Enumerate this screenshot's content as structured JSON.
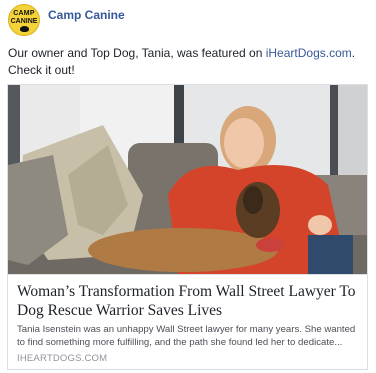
{
  "post": {
    "page_name": "Camp Canine",
    "avatar": {
      "logo_top": "CAMP",
      "logo_bottom": "CANINE",
      "colors": {
        "background": "#f3d23a",
        "text": "#111111"
      }
    },
    "text_before": "Our owner and Top Dog, Tania, was featured on ",
    "link_text": "iHeartDogs.com",
    "text_after": ". Check it out!"
  },
  "link_card": {
    "image_icon": "woman-hugging-dog-photo",
    "title": "Woman’s Transformation From Wall Street Lawyer To Dog Rescue Warrior Saves Lives",
    "description": "Tania Isenstein was an unhappy Wall Street lawyer for many years. She wanted to find something more fulfilling, and the path she found led her to dedicate...",
    "domain": "IHEARTDOGS.COM"
  },
  "colors": {
    "link": "#365899",
    "text": "#1d2129",
    "muted": "#90949c",
    "border": "#dddfe2"
  }
}
